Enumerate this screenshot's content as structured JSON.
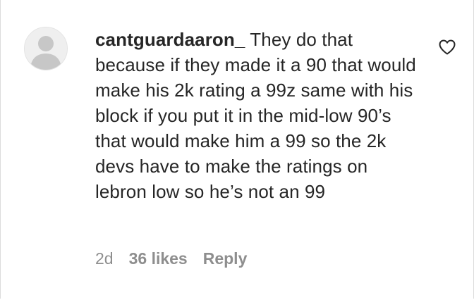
{
  "comment": {
    "avatar_icon": "default-profile-avatar-icon",
    "username": "cantguardaaron_",
    "text": " They do that because if they made it a 90 that would make his 2k rating a 99z same with his block if you put it in the mid-low 90’s that would make him a 99 so the 2k devs have to make the ratings on lebron low so he’s not an 99",
    "like_icon": "heart-outline-icon",
    "timestamp": "2d",
    "likes": "36 likes",
    "reply_label": "Reply"
  },
  "colors": {
    "text": "#262626",
    "secondary": "#8e8e8e",
    "avatar_bg": "#efefef",
    "avatar_figure": "#c7c7c7"
  }
}
